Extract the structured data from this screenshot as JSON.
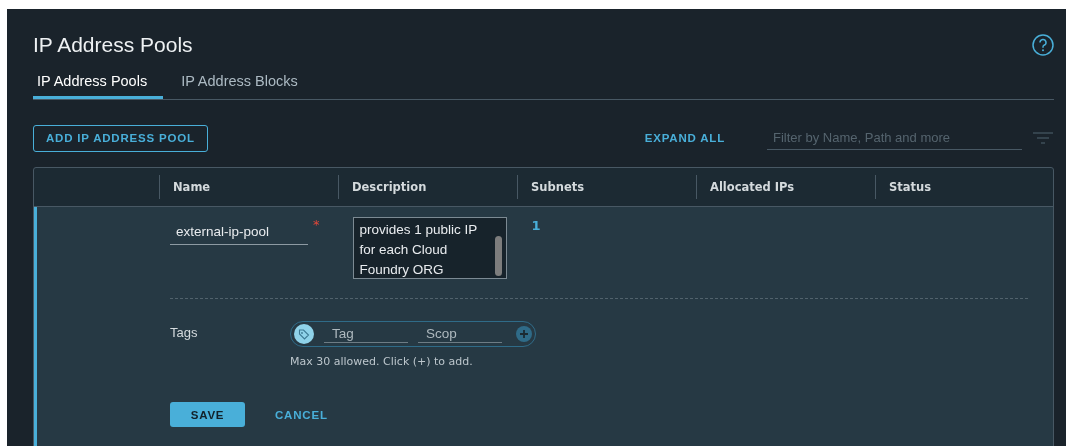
{
  "page": {
    "title": "IP Address Pools"
  },
  "tabs": [
    {
      "label": "IP Address Pools",
      "selected": true
    },
    {
      "label": "IP Address Blocks",
      "selected": false
    }
  ],
  "toolbar": {
    "add_button": "ADD IP ADDRESS POOL",
    "expand_all": "EXPAND ALL",
    "filter": {
      "placeholder": "Filter by Name, Path and more"
    }
  },
  "table": {
    "columns": [
      "Name",
      "Description",
      "Subnets",
      "Allocated IPs",
      "Status"
    ],
    "edit_row": {
      "name": {
        "value": "external-ip-pool",
        "required_mark": "*"
      },
      "description": {
        "value": "provides 1 public IP for each Cloud Foundry ORG"
      },
      "subnets": "1",
      "tags": {
        "label": "Tags",
        "tag_placeholder": "Tag",
        "scope_placeholder": "Scop",
        "hint": "Max 30 allowed. Click (+) to add."
      },
      "buttons": [
        {
          "label": "SAVE",
          "kind": "primary"
        },
        {
          "label": "CANCEL",
          "kind": "link"
        }
      ]
    }
  }
}
